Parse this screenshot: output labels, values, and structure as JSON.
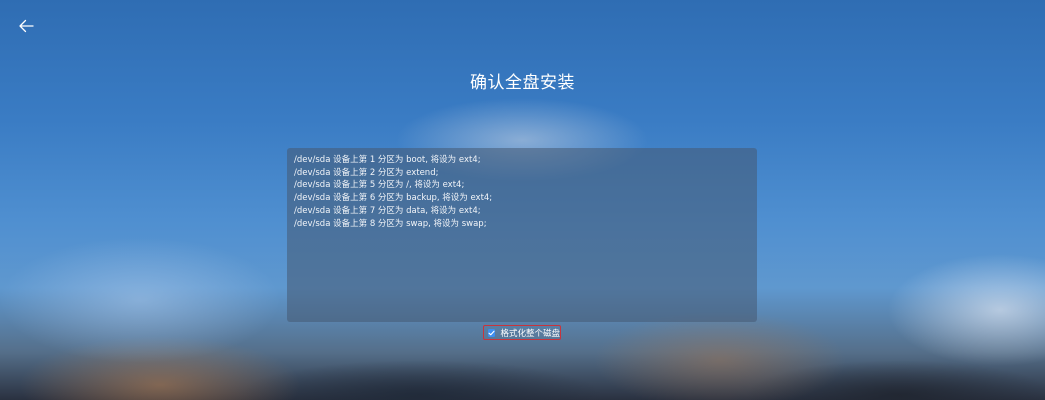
{
  "header": {
    "back_icon": "arrow-left-icon",
    "title": "确认全盘安装"
  },
  "partitions": [
    "/dev/sda 设备上第 1 分区为 boot, 将设为 ext4;",
    "/dev/sda 设备上第 2 分区为 extend;",
    "/dev/sda 设备上第 5 分区为 /, 将设为 ext4;",
    "/dev/sda 设备上第 6 分区为 backup, 将设为 ext4;",
    "/dev/sda 设备上第 7 分区为 data, 将设为 ext4;",
    "/dev/sda 设备上第 8 分区为 swap, 将设为 swap;"
  ],
  "format_option": {
    "label": "格式化整个磁盘",
    "checked": true,
    "check_icon": "checkmark-icon"
  },
  "colors": {
    "checkbox": "#3d8ef0",
    "highlight_border": "#c8343c"
  }
}
